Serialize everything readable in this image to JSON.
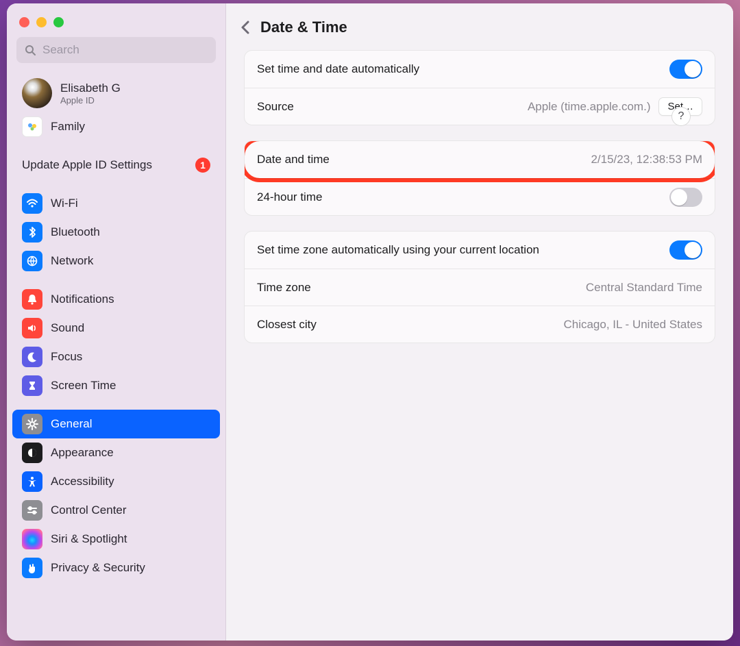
{
  "window": {
    "search_placeholder": "Search"
  },
  "account": {
    "name": "Elisabeth G",
    "sub": "Apple ID"
  },
  "sidebar": {
    "family": "Family",
    "update_label": "Update Apple ID Settings",
    "update_badge": "1",
    "items": [
      {
        "label": "Wi-Fi"
      },
      {
        "label": "Bluetooth"
      },
      {
        "label": "Network"
      },
      {
        "label": "Notifications"
      },
      {
        "label": "Sound"
      },
      {
        "label": "Focus"
      },
      {
        "label": "Screen Time"
      },
      {
        "label": "General"
      },
      {
        "label": "Appearance"
      },
      {
        "label": "Accessibility"
      },
      {
        "label": "Control Center"
      },
      {
        "label": "Siri & Spotlight"
      },
      {
        "label": "Privacy & Security"
      }
    ]
  },
  "header": {
    "title": "Date & Time"
  },
  "settings": {
    "auto_time_label": "Set time and date automatically",
    "auto_time_on": true,
    "source_label": "Source",
    "source_value": "Apple (time.apple.com.)",
    "source_button": "Set…",
    "datetime_label": "Date and time",
    "datetime_value": "2/15/23, 12:38:53 PM",
    "twentyfour_label": "24-hour time",
    "twentyfour_on": false,
    "auto_tz_label": "Set time zone automatically using your current location",
    "auto_tz_on": true,
    "timezone_label": "Time zone",
    "timezone_value": "Central Standard Time",
    "city_label": "Closest city",
    "city_value": "Chicago, IL - United States",
    "help": "?"
  }
}
